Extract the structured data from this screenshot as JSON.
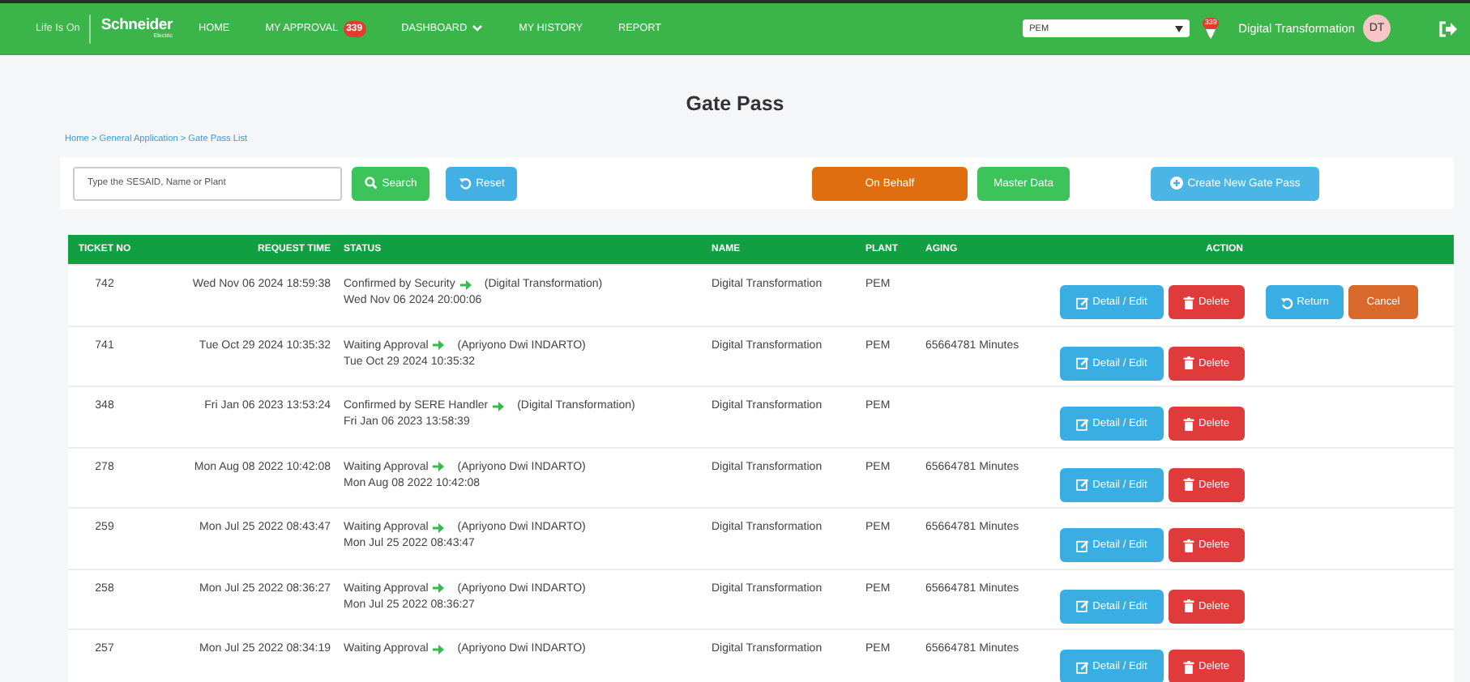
{
  "navbar": {
    "tagline": "Life Is On",
    "brand": "Schneider",
    "brand_sub": "Electric",
    "menu": [
      {
        "label": "HOME",
        "dropdown": false
      },
      {
        "label": "MY APPROVAL",
        "badge": "339",
        "dropdown": false
      },
      {
        "label": "DASHBOARD",
        "dropdown": true
      },
      {
        "label": "MY HISTORY",
        "dropdown": false
      },
      {
        "label": "REPORT",
        "dropdown": false
      }
    ],
    "plant_select": "PEM",
    "notification_count": "339",
    "user_name": "Digital Transformation",
    "user_initials": "DT"
  },
  "page": {
    "title": "Gate Pass",
    "breadcrumb": "Home > General Application > Gate Pass List"
  },
  "toolbar": {
    "search_placeholder": "Type the SESAID, Name or Plant",
    "buttons": [
      {
        "kind": "search",
        "label": "Search"
      },
      {
        "kind": "reset",
        "label": "Reset"
      },
      {
        "kind": "behalf",
        "label": "On Behalf"
      },
      {
        "kind": "master",
        "label": "Master Data"
      },
      {
        "kind": "create",
        "label": "Create New Gate Pass"
      }
    ]
  },
  "table": {
    "columns": [
      "TICKET NO",
      "REQUEST TIME",
      "STATUS",
      "NAME",
      "PLANT",
      "AGING",
      "ACTION"
    ],
    "rows": [
      {
        "ticket": "742",
        "request_time": "Wed Nov 06 2024 18:59:38",
        "status": "Confirmed by Security",
        "actor": "(Digital Transformation)",
        "status_time": "Wed Nov 06 2024 20:00:06",
        "name": "Digital Transformation",
        "plant": "PEM",
        "actions": [
          {
            "kind": "edit",
            "label": "Detail / Edit"
          },
          {
            "kind": "delete",
            "label": "Delete"
          },
          {
            "kind": "return",
            "label": "Return"
          },
          {
            "kind": "cancel",
            "label": "Cancel"
          }
        ]
      },
      {
        "ticket": "741",
        "request_time": "Tue Oct 29 2024 10:35:32",
        "status": "Waiting Approval",
        "actor": "(Apriyono Dwi INDARTO)",
        "status_time": "Tue Oct 29 2024 10:35:32",
        "name": "Digital Transformation",
        "plant": "PEM",
        "aging": "65664781 Minutes",
        "actions": [
          {
            "kind": "edit",
            "label": "Detail / Edit"
          },
          {
            "kind": "delete",
            "label": "Delete"
          }
        ]
      },
      {
        "ticket": "348",
        "request_time": "Fri Jan 06 2023 13:53:24",
        "status": "Confirmed by SERE Handler",
        "actor": "(Digital Transformation)",
        "status_time": "Fri Jan 06 2023 13:58:39",
        "name": "Digital Transformation",
        "plant": "PEM",
        "actions": [
          {
            "kind": "edit",
            "label": "Detail / Edit"
          },
          {
            "kind": "delete",
            "label": "Delete"
          }
        ]
      },
      {
        "ticket": "278",
        "request_time": "Mon Aug 08 2022 10:42:08",
        "status": "Waiting Approval",
        "actor": "(Apriyono Dwi INDARTO)",
        "status_time": "Mon Aug 08 2022 10:42:08",
        "name": "Digital Transformation",
        "plant": "PEM",
        "aging": "65664781 Minutes",
        "actions": [
          {
            "kind": "edit",
            "label": "Detail / Edit"
          },
          {
            "kind": "delete",
            "label": "Delete"
          }
        ]
      },
      {
        "ticket": "259",
        "request_time": "Mon Jul 25 2022 08:43:47",
        "status": "Waiting Approval",
        "actor": "(Apriyono Dwi INDARTO)",
        "status_time": "Mon Jul 25 2022 08:43:47",
        "name": "Digital Transformation",
        "plant": "PEM",
        "aging": "65664781 Minutes",
        "actions": [
          {
            "kind": "edit",
            "label": "Detail / Edit"
          },
          {
            "kind": "delete",
            "label": "Delete"
          }
        ]
      },
      {
        "ticket": "258",
        "request_time": "Mon Jul 25 2022 08:36:27",
        "status": "Waiting Approval",
        "actor": "(Apriyono Dwi INDARTO)",
        "status_time": "Mon Jul 25 2022 08:36:27",
        "name": "Digital Transformation",
        "plant": "PEM",
        "aging": "65664781 Minutes",
        "actions": [
          {
            "kind": "edit",
            "label": "Detail / Edit"
          },
          {
            "kind": "delete",
            "label": "Delete"
          }
        ]
      },
      {
        "ticket": "257",
        "request_time": "Mon Jul 25 2022 08:34:19",
        "status": "Waiting Approval",
        "actor": "(Apriyono Dwi INDARTO)",
        "name": "Digital Transformation",
        "plant": "PEM",
        "aging": "65664781 Minutes",
        "actions": [
          {
            "kind": "edit",
            "label": "Detail / Edit"
          },
          {
            "kind": "delete",
            "label": "Delete"
          }
        ]
      }
    ]
  }
}
